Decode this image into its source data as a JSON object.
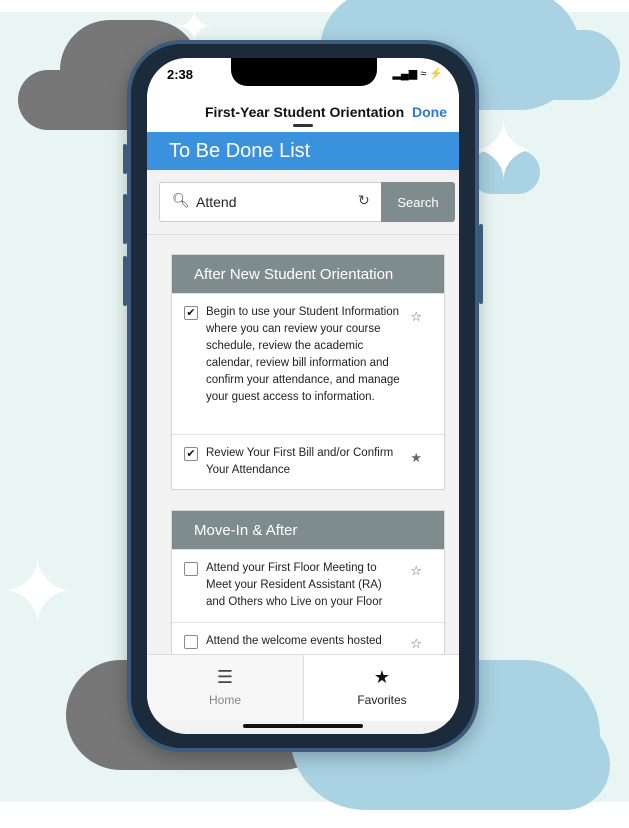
{
  "status": {
    "time": "2:38",
    "icons": "▂▄▆ ≈ ⚡"
  },
  "nav": {
    "title": "First-Year Student Orientation",
    "done_label": "Done"
  },
  "header": {
    "title": "To Be Done List"
  },
  "search": {
    "value": "Attend",
    "button_label": "Search"
  },
  "sections": [
    {
      "title": "After New Student Orientation",
      "items": [
        {
          "text": "Begin to use your Student Information where you can review your course schedule, review the academic calendar, review bill information and confirm your attendance, and manage your guest access to information.",
          "checked": "✔",
          "star": "☆"
        },
        {
          "text": "Review Your First Bill and/or Confirm Your Attendance",
          "checked": "✔",
          "star": "★"
        }
      ]
    },
    {
      "title": "Move-In & After",
      "items": [
        {
          "text": "Attend your First Floor Meeting to Meet your Resident Assistant (RA) and Others who Live on your Floor",
          "checked": "",
          "star": "☆"
        },
        {
          "text": "Attend the welcome events hosted",
          "checked": "",
          "star": "☆"
        }
      ]
    }
  ],
  "tabs": [
    {
      "label": "Home",
      "icon": "☰"
    },
    {
      "label": "Favorites",
      "icon": "★"
    }
  ],
  "colors": {
    "accent": "#3a92de",
    "section_header": "#7f8c8d",
    "done": "#2f7ad0"
  }
}
